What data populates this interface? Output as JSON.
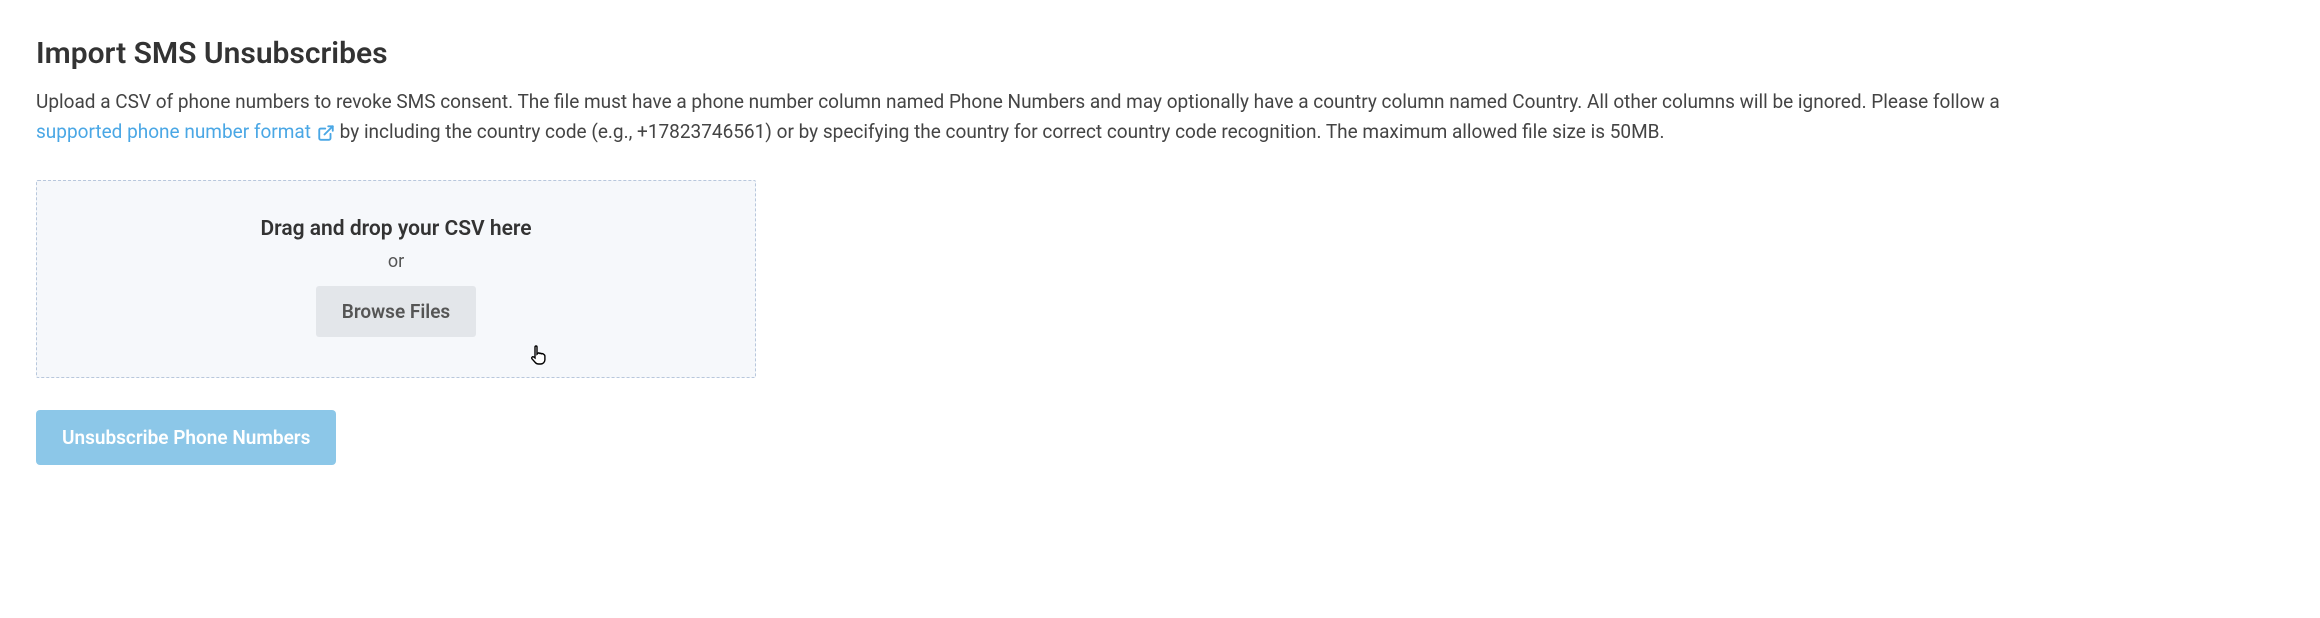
{
  "page": {
    "title": "Import SMS Unsubscribes",
    "description_part1": "Upload a CSV of phone numbers to revoke SMS consent. The file must have a phone number column named Phone Numbers and may optionally have a country column named Country. All other columns will be ignored. Please follow a ",
    "link_text": "supported phone number format",
    "description_part2": " by including the country code (e.g., +17823746561) or by specifying the country for correct country code recognition. The maximum allowed file size is 50MB."
  },
  "dropzone": {
    "title": "Drag and drop your CSV here",
    "or_text": "or",
    "browse_label": "Browse Files"
  },
  "submit": {
    "label": "Unsubscribe Phone Numbers"
  }
}
